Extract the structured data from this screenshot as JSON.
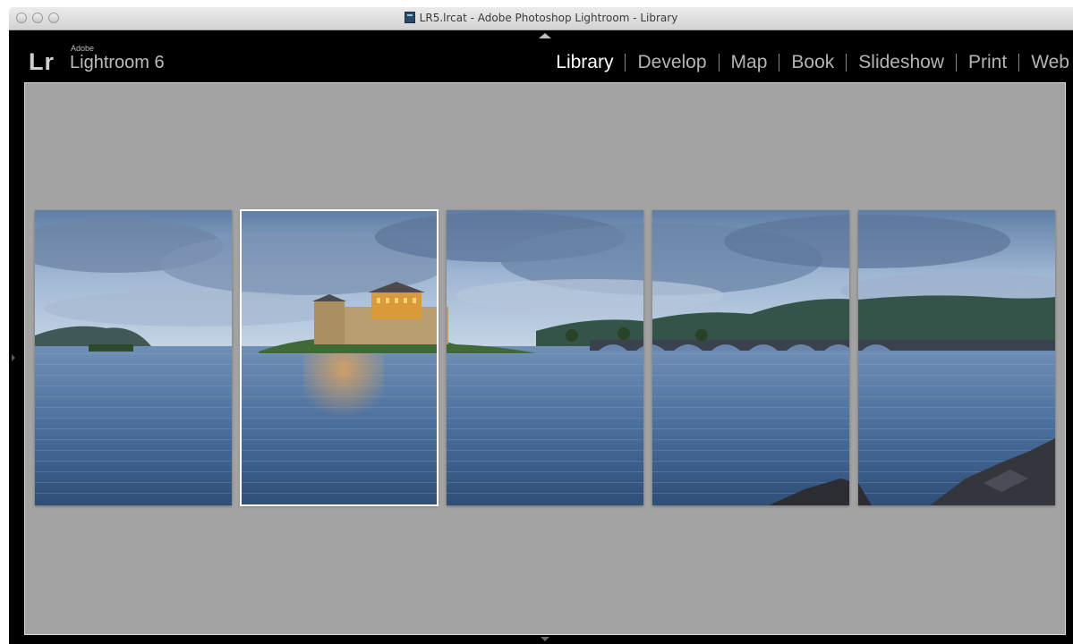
{
  "window": {
    "title": "LR5.lrcat - Adobe Photoshop Lightroom - Library",
    "icon": "lightroom-catalog-icon"
  },
  "identity_plate": {
    "mark": "Lr",
    "vendor": "Adobe",
    "product": "Lightroom 6"
  },
  "modules": [
    {
      "label": "Library",
      "active": true
    },
    {
      "label": "Develop",
      "active": false
    },
    {
      "label": "Map",
      "active": false
    },
    {
      "label": "Book",
      "active": false
    },
    {
      "label": "Slideshow",
      "active": false
    },
    {
      "label": "Print",
      "active": false
    },
    {
      "label": "Web",
      "active": false
    }
  ],
  "loupe": {
    "selected_index": 1,
    "photo_count": 5,
    "subject": "castle-on-loch-panorama-tiles"
  },
  "colors": {
    "panel_background": "#000000",
    "stage_background": "#a3a3a3",
    "selection_border": "#ffffff",
    "active_module": "#ffffff",
    "inactive_module": "#b4b4b4"
  }
}
